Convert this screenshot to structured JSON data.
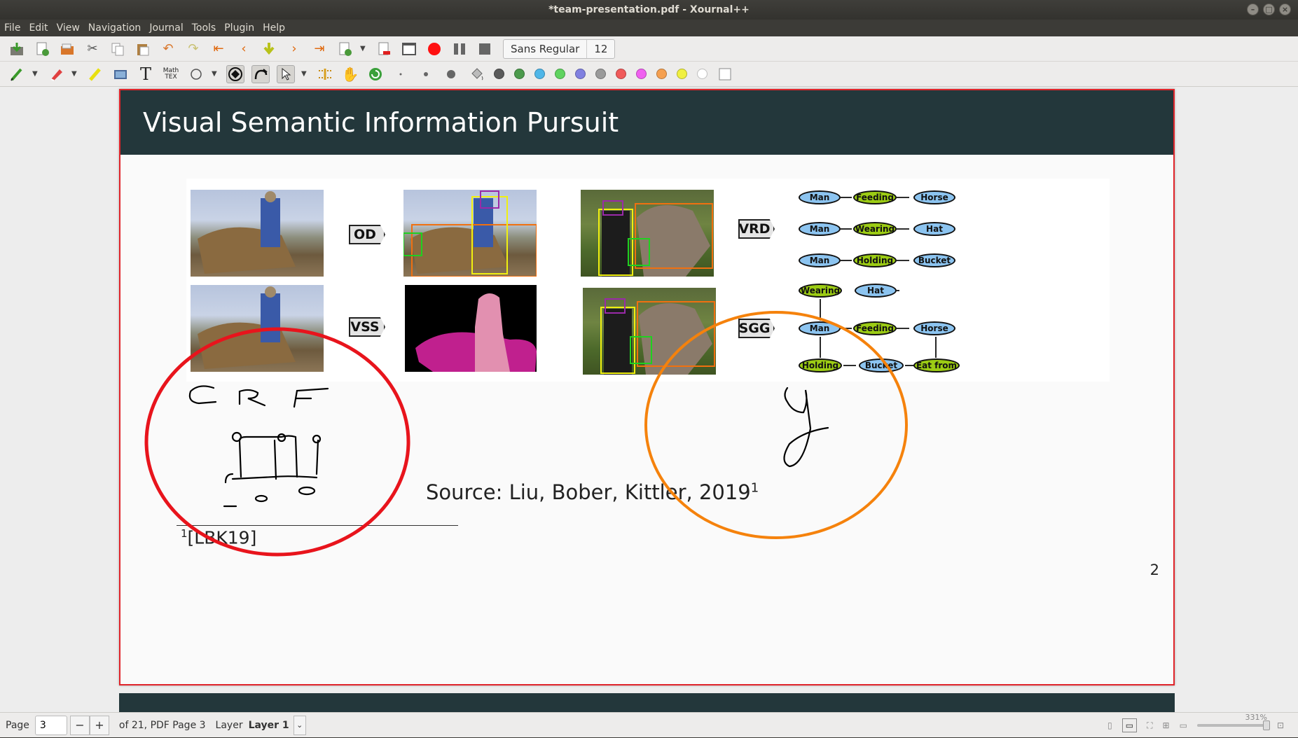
{
  "window": {
    "title": "*team-presentation.pdf - Xournal++"
  },
  "menu": [
    "File",
    "Edit",
    "View",
    "Navigation",
    "Journal",
    "Tools",
    "Plugin",
    "Help"
  ],
  "toolbar": {
    "font_name": "Sans Regular",
    "font_size": "12",
    "math_tex_label": "Math TEX",
    "text_tool_label": "T",
    "colors": [
      "#5a5a5a",
      "#4c9a4c",
      "#4fb6e8",
      "#5fd35f",
      "#8080e0",
      "#9a9a9a",
      "#f05a5a",
      "#f060f0",
      "#f5a050",
      "#f0f040",
      "#ffffff"
    ]
  },
  "slide": {
    "title": "Visual Semantic Information Pursuit",
    "labels": {
      "od": "OD",
      "vss": "VSS",
      "vrd": "VRD",
      "sgg": "SGG"
    },
    "vrd_rows": [
      [
        "Man",
        "Feeding",
        "Horse"
      ],
      [
        "Man",
        "Wearing",
        "Hat"
      ],
      [
        "Man",
        "Holding",
        "Bucket"
      ]
    ],
    "sgg_nodes": {
      "wearing": "Wearing",
      "hat": "Hat",
      "man": "Man",
      "feeding": "Feeding",
      "horse": "Horse",
      "holding": "Holding",
      "bucket": "Bucket",
      "eat_from": "Eat from"
    },
    "source_text": "Source: Liu, Bober, Kittler, 2019",
    "source_sup": "1",
    "footnote_sup": "1",
    "footnote_text": "[LBK19]",
    "page_number": "2"
  },
  "annotations": {
    "crf_text": "C R F",
    "y_text": "y",
    "circle_colors": {
      "left": "#e8141c",
      "right": "#f5820c"
    }
  },
  "status": {
    "page_label": "Page",
    "page_value": "3",
    "minus": "−",
    "plus": "+",
    "page_of": "of 21, PDF Page 3",
    "layer_label": "Layer",
    "layer_value": "Layer 1",
    "zoom": "331%"
  }
}
